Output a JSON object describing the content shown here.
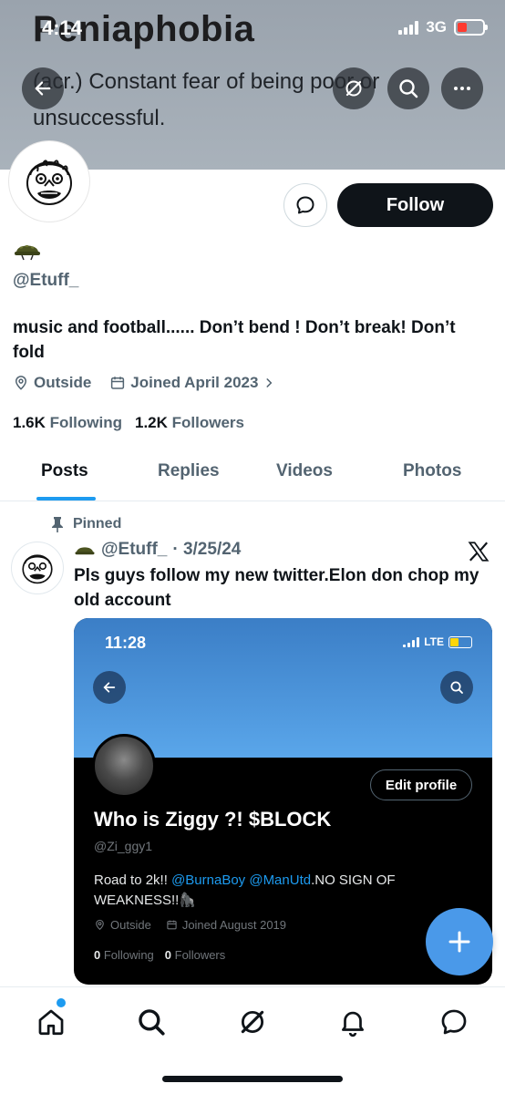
{
  "status_bar": {
    "time": "4:14",
    "network": "3G"
  },
  "banner": {
    "word": "Peniaphobia",
    "definition": "(acr.) Constant fear of being poor or unsuccessful."
  },
  "header_icons": [
    "back-arrow-icon",
    "grok-icon",
    "search-icon",
    "more-icon"
  ],
  "profile": {
    "emoji": "🪖",
    "handle": "@Etuff_",
    "bio": "music and football...... Don’t bend ! Don’t break! Don’t fold",
    "location": "Outside",
    "joined": "Joined April 2023",
    "following_count": "1.6K",
    "following_label": "Following",
    "followers_count": "1.2K",
    "followers_label": "Followers",
    "follow_label": "Follow"
  },
  "tabs": [
    {
      "label": "Posts",
      "active": true
    },
    {
      "label": "Replies",
      "active": false
    },
    {
      "label": "Videos",
      "active": false
    },
    {
      "label": "Photos",
      "active": false
    }
  ],
  "post": {
    "pinned_label": "Pinned",
    "emoji": "🪖",
    "handle": "@Etuff_",
    "date": "· 3/25/24",
    "text": "Pls guys follow my new twitter.Elon don chop my old account"
  },
  "embedded_screenshot": {
    "time": "11:28",
    "network": "LTE",
    "edit_label": "Edit profile",
    "name": "Who is Ziggy ?! $BLOCK",
    "handle": "@Zi_ggy1",
    "bio_prefix": "Road to 2k!! ",
    "mention1": "@BurnaBoy",
    "mention2": " @ManUtd",
    "bio_suffix": ".NO SIGN OF WEAKNESS!!🦍",
    "location": "Outside",
    "joined": "Joined August 2019",
    "following_count": "0",
    "following_label": "Following",
    "followers_count": "0",
    "followers_label": "Followers"
  },
  "colors": {
    "accent": "#1d9bf0",
    "text": "#0f1419",
    "muted": "#536471",
    "fab": "#4a99e9"
  },
  "nav": [
    "home-icon",
    "search-icon",
    "grok-icon",
    "notifications-icon",
    "messages-icon"
  ]
}
